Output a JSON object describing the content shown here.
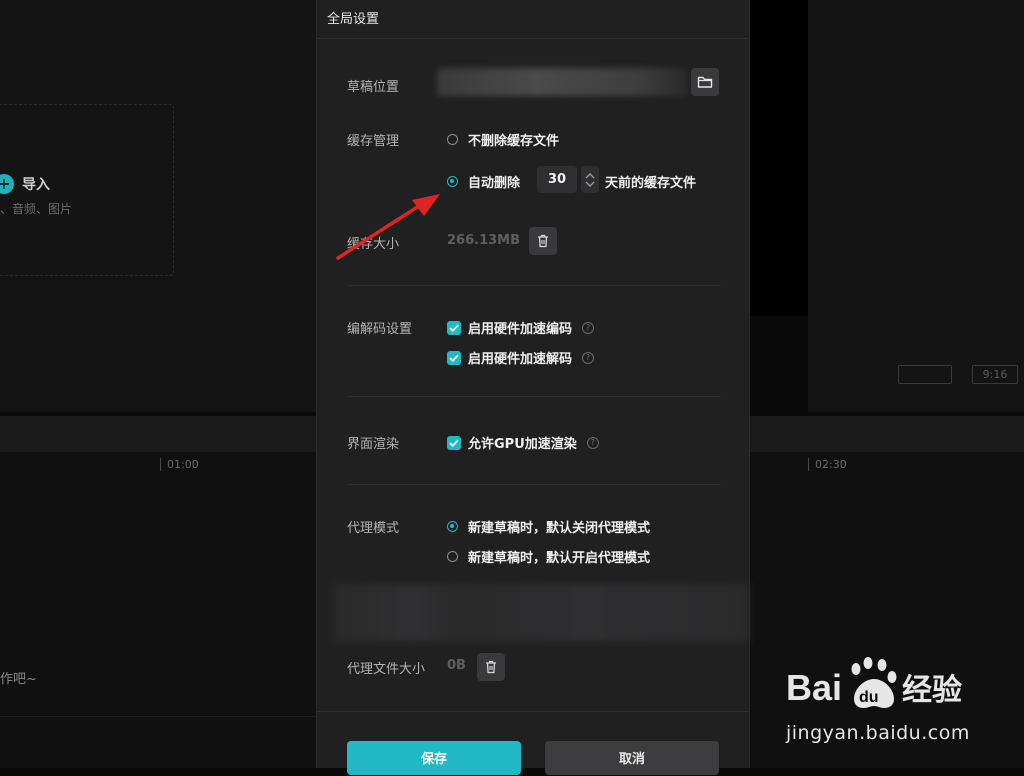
{
  "background": {
    "import_label": "导入",
    "import_hint": "、音频、图片",
    "ratio_buttons": [
      "",
      "9:16"
    ],
    "timeline_ticks": [
      "01:00",
      "02:30"
    ],
    "timeline_hint": "作吧~"
  },
  "dialog": {
    "title": "全局设置",
    "draft_location": {
      "label": "草稿位置",
      "folder_icon": "folder-icon"
    },
    "cache": {
      "label": "缓存管理",
      "option_keep": "不删除缓存文件",
      "option_auto": "自动删除",
      "days": "30",
      "days_suffix": "天前的缓存文件",
      "selected": "auto"
    },
    "cache_size": {
      "label": "缓存大小",
      "value": "266.13MB",
      "icon": "trash-icon"
    },
    "codec": {
      "label": "编解码设置",
      "hw_encode": "启用硬件加速编码",
      "hw_decode": "启用硬件加速解码",
      "hw_encode_checked": true,
      "hw_decode_checked": true
    },
    "render": {
      "label": "界面渲染",
      "gpu": "允许GPU加速渲染",
      "gpu_checked": true
    },
    "proxy": {
      "label": "代理模式",
      "option_off": "新建草稿时，默认关闭代理模式",
      "option_on": "新建草稿时，默认开启代理模式",
      "selected": "off"
    },
    "proxy_size": {
      "label": "代理文件大小",
      "value": "0B",
      "icon": "trash-icon"
    },
    "buttons": {
      "save": "保存",
      "cancel": "取消"
    }
  },
  "watermark": {
    "brand_left": "Bai",
    "brand_right": "du",
    "brand_cn": "经验",
    "url": "jingyan.baidu.com"
  },
  "colors": {
    "accent": "#20b9c5",
    "annotation": "#e02424",
    "dialog_bg": "#202021"
  }
}
